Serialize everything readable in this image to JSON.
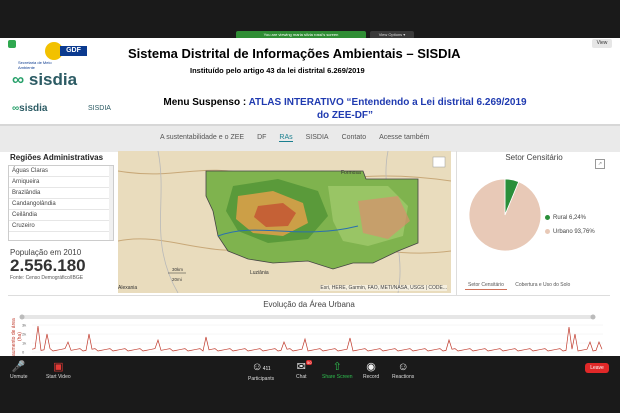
{
  "zoom": {
    "notice": "You are viewing maria silvia rossi's screen",
    "view_options": "View Options ▾",
    "view_button": "View"
  },
  "slide": {
    "gdf_org": "Secretaria de Meio Ambiente",
    "gdf_tag": "GDF",
    "logo": "sisdia",
    "title": "Sistema Distrital de Informações Ambientais – SISDIA",
    "subtitle": "Instituído pelo artigo 43 da lei distrital 6.269/2019",
    "menu_key": "Menu Suspenso : ",
    "menu_value": "ATLAS INTERATIVO “Entendendo a Lei distrital 6.269/2019 do ZEE-DF”"
  },
  "site": {
    "logo": "sisdia",
    "logo_label": "SISDIA",
    "nav": [
      "A sustentabilidade e o ZEE",
      "DF",
      "RAs",
      "SISDIA",
      "Contato",
      "Acesse também"
    ],
    "nav_active": 2
  },
  "regions": {
    "heading": "Regiões Administrativas",
    "items": [
      "Águas Claras",
      "Arniqueira",
      "Brazlândia",
      "Candangolândia",
      "Ceilândia",
      "Cruzeiro"
    ]
  },
  "population": {
    "label": "População em 2010",
    "value": "2.556.180",
    "source": "Fonte: Censo Demográfico/IBGE"
  },
  "map": {
    "attribution": "Esri, HERE, Garmin, FAO, METI/NASA, USGS | CODE...",
    "scale_km": "30km",
    "scale_mi": "20mi",
    "places": [
      "Formosa",
      "Luziânia",
      "Alexania"
    ]
  },
  "setor": {
    "heading": "Setor Censitário",
    "tabs": [
      "Setor Censitário",
      "Cobertura e Uso do Solo"
    ]
  },
  "chart_data": {
    "type": "pie",
    "title": "Setor Censitário",
    "series": [
      {
        "name": "Rural",
        "value": 6.24,
        "label": "Rural 6,24%",
        "color": "#2a8f3a"
      },
      {
        "name": "Urbano",
        "value": 93.76,
        "label": "Urbano 93,76%",
        "color": "#e8c9b7"
      }
    ]
  },
  "evolution": {
    "heading": "Evolução da Área Urbana",
    "ylabel": "aumento de área (ha)",
    "ticks": [
      "3k",
      "2k",
      "1k",
      "0"
    ]
  },
  "toolbar": {
    "unmute": "Unmute",
    "start_video": "Start Video",
    "participants": "Participants",
    "participant_count": "411",
    "chat": "Chat",
    "chat_badge": "50",
    "share": "Share Screen",
    "record": "Record",
    "reactions": "Reactions",
    "leave": "Leave"
  }
}
